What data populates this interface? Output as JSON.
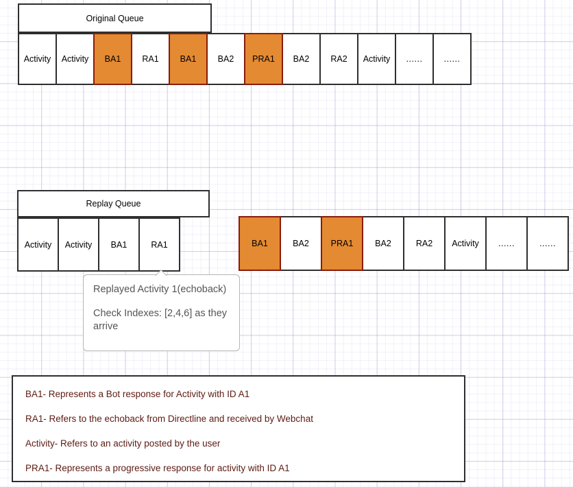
{
  "diagram": {
    "title_hidden": "",
    "original_queue": {
      "header_label": "Original Queue",
      "cells": [
        {
          "label": "Activity",
          "highlight": false
        },
        {
          "label": "Activity",
          "highlight": false
        },
        {
          "label": "BA1",
          "highlight": true
        },
        {
          "label": "RA1",
          "highlight": false
        },
        {
          "label": "BA1",
          "highlight": true
        },
        {
          "label": "BA2",
          "highlight": false
        },
        {
          "label": "PRA1",
          "highlight": true
        },
        {
          "label": "BA2",
          "highlight": false
        },
        {
          "label": "RA2",
          "highlight": false
        },
        {
          "label": "Activity",
          "highlight": false
        },
        {
          "label": "......",
          "highlight": false
        },
        {
          "label": "......",
          "highlight": false
        }
      ]
    },
    "replay_queue": {
      "header_label": "Replay Queue",
      "cells": [
        {
          "label": "Activity",
          "highlight": false
        },
        {
          "label": "Activity",
          "highlight": false
        },
        {
          "label": "BA1",
          "highlight": false
        },
        {
          "label": "RA1",
          "highlight": false
        }
      ]
    },
    "pending_queue": {
      "cells": [
        {
          "label": "BA1",
          "highlight": true
        },
        {
          "label": "BA2",
          "highlight": false
        },
        {
          "label": "PRA1",
          "highlight": true
        },
        {
          "label": "BA2",
          "highlight": false
        },
        {
          "label": "RA2",
          "highlight": false
        },
        {
          "label": "Activity",
          "highlight": false
        },
        {
          "label": "......",
          "highlight": false
        },
        {
          "label": "......",
          "highlight": false
        }
      ]
    },
    "callout": {
      "line1": "Replayed Activity 1(echoback)",
      "line2": "Check Indexes: [2,4,6] as they arrive"
    },
    "legend": {
      "lines": [
        "BA1- Represents a Bot response for Activity with ID A1",
        "RA1- Refers to the echoback from Directline and received by Webchat",
        "Activity- Refers to an activity posted by the user",
        "PRA1- Represents a progressive response for activity with ID A1"
      ]
    },
    "colors": {
      "highlight_fill": "#E38A33",
      "highlight_border": "#8B1A0A",
      "cell_border": "#2E2E2E",
      "legend_text": "#5C1A12",
      "callout_text": "#555555",
      "grid_line": "#C9C9E8"
    }
  }
}
